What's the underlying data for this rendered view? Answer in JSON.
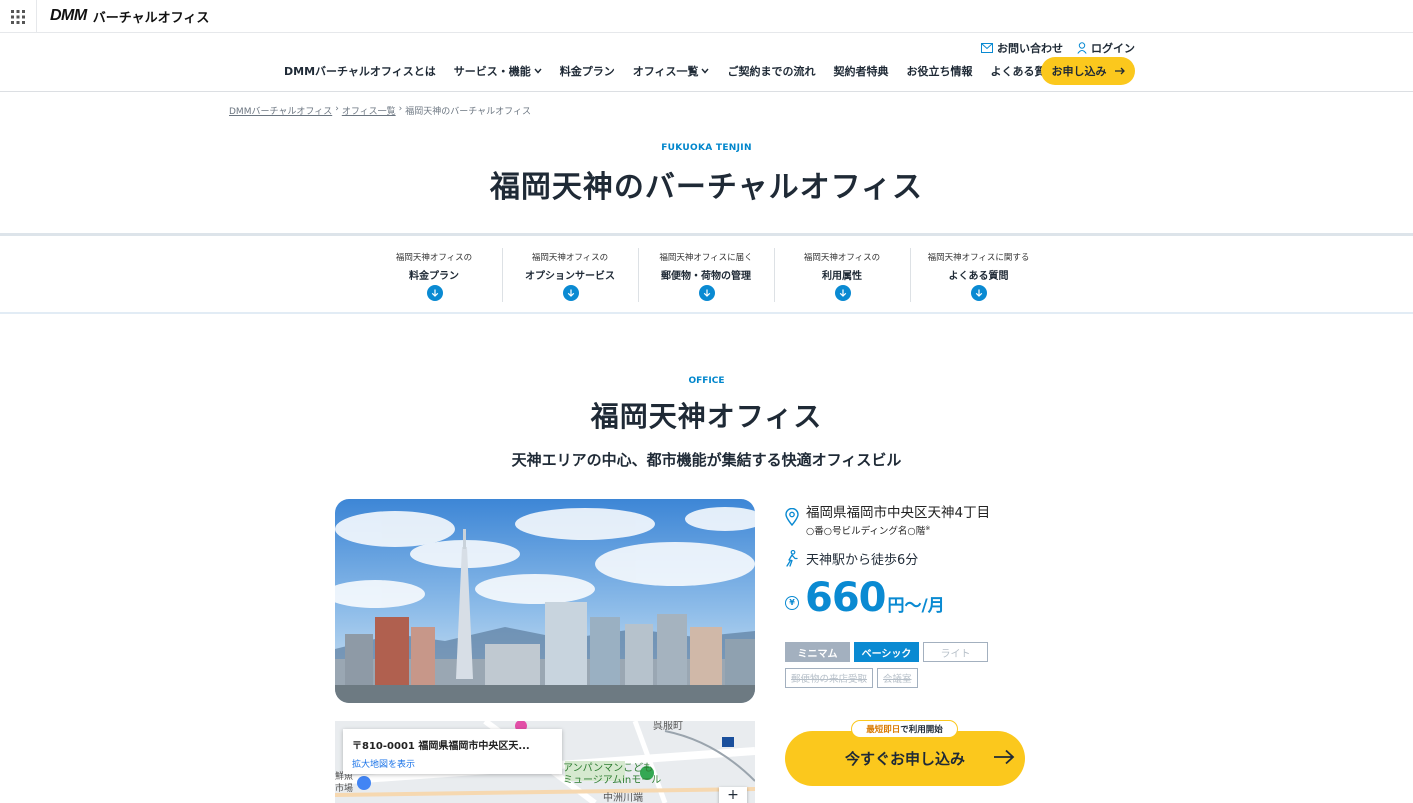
{
  "header": {
    "logo_dmm": "DMM",
    "logo_service": "バーチャルオフィス",
    "contact": "お問い合わせ",
    "login": "ログイン"
  },
  "nav": {
    "items": [
      "DMMバーチャルオフィスとは",
      "サービス・機能",
      "料金プラン",
      "オフィス一覧",
      "ご契約までの流れ",
      "契約者特典",
      "お役立ち情報",
      "よくある質問"
    ],
    "apply": "お申し込み"
  },
  "breadcrumb": [
    "DMMバーチャルオフィス",
    "オフィス一覧",
    "福岡天神のバーチャルオフィス"
  ],
  "hero": {
    "en": "FUKUOKA TENJIN",
    "title": "福岡天神のバーチャルオフィス"
  },
  "anchors": [
    {
      "small": "福岡天神オフィスの",
      "bold": "料金プラン"
    },
    {
      "small": "福岡天神オフィスの",
      "bold": "オプションサービス"
    },
    {
      "small": "福岡天神オフィスに届く",
      "bold": "郵便物・荷物の管理"
    },
    {
      "small": "福岡天神オフィスの",
      "bold": "利用属性"
    },
    {
      "small": "福岡天神オフィスに関する",
      "bold": "よくある質問"
    }
  ],
  "office": {
    "en": "OFFICE",
    "title": "福岡天神オフィス",
    "subtitle": "天神エリアの中心、都市機能が集結する快適オフィスビル",
    "address1": "福岡県福岡市中央区天神4丁目",
    "address2": "○番○号ビルディング名○階",
    "address_note": "※",
    "access": "天神駅から徒歩6分",
    "price": "660",
    "price_unit": "円〜/月",
    "yen_symbol": "¥",
    "plans": [
      "ミニマム",
      "ベーシック",
      "ライト"
    ],
    "options": [
      "郵便物の来店受取",
      "会議室"
    ]
  },
  "map": {
    "address": "〒810-0001 福岡県福岡市中央区天...",
    "link": "拡大地図を表示",
    "zoom": "+"
  },
  "cta": {
    "badge_highlight": "最短即日",
    "badge_rest": "で利用開始",
    "label": "今すぐお申し込み"
  },
  "colors": {
    "accent": "#0a8ad2",
    "yellow": "#fbc81d",
    "text": "#1f2a36"
  }
}
